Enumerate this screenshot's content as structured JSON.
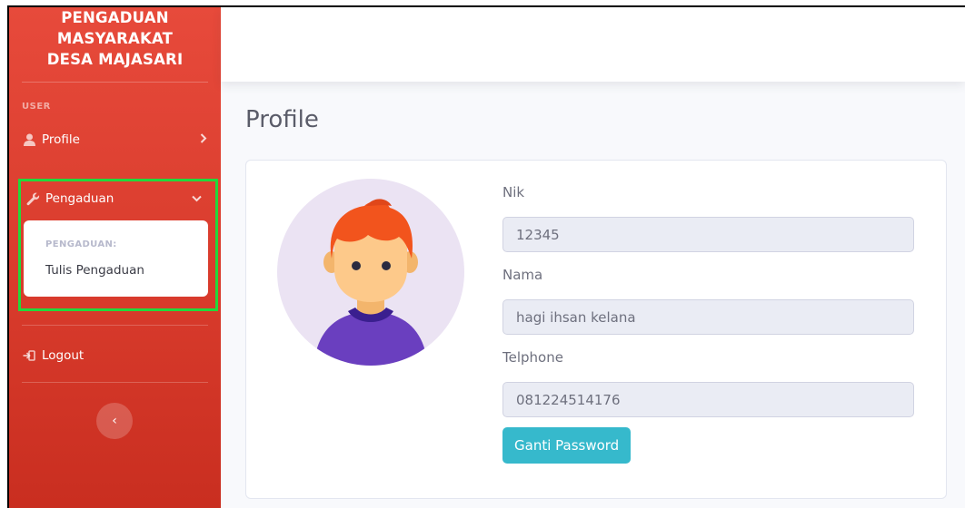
{
  "brand": {
    "line1": "PENGADUAN",
    "line2": "MASYARAKAT",
    "line3": "DESA MAJASARI"
  },
  "sidebar": {
    "section": "USER",
    "profile_label": "Profile",
    "pengaduan_label": "Pengaduan",
    "submenu_header": "PENGADUAN:",
    "submenu_item": "Tulis Pengaduan",
    "logout_label": "Logout",
    "toggle_glyph": "‹"
  },
  "page": {
    "title": "Profile"
  },
  "profile": {
    "nik_label": "Nik",
    "nik_value": "12345",
    "nama_label": "Nama",
    "nama_value": "hagi ihsan kelana",
    "telp_label": "Telphone",
    "telp_value": "081224514176",
    "button_label": "Ganti Password"
  },
  "colors": {
    "sidebar": "#e74a3b",
    "button": "#36b9cc",
    "highlight": "#22d83b"
  }
}
